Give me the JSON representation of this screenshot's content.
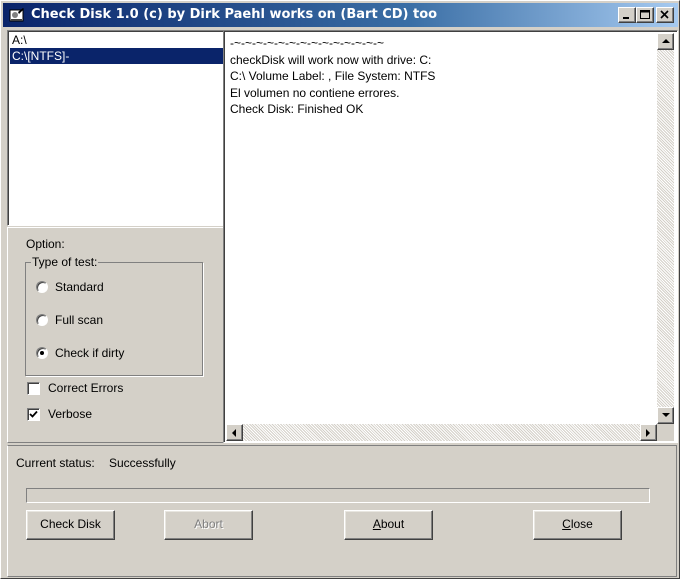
{
  "window": {
    "title": "Check Disk 1.0  (c) by Dirk Paehl works on (Bart CD) too",
    "app_icon": "checkdisk-app-icon",
    "controls": [
      "minimize-icon",
      "maximize-icon",
      "close-icon"
    ]
  },
  "drives": {
    "items": [
      {
        "label": "A:\\",
        "selected": false
      },
      {
        "label": "C:\\[NTFS]-",
        "selected": true
      }
    ]
  },
  "options": {
    "title": "Option:",
    "type_of_test": {
      "title": "Type of test:",
      "choices": [
        {
          "label": "Standard",
          "checked": false
        },
        {
          "label": "Full scan",
          "checked": false
        },
        {
          "label": "Check if dirty",
          "checked": true
        }
      ]
    },
    "correct_errors": {
      "label": "Correct Errors",
      "checked": false
    },
    "verbose": {
      "label": "Verbose",
      "checked": true
    }
  },
  "output": {
    "lines": [
      "-~-~-~-~-~-~-~-~-~-~-~-~-~-~",
      "checkDisk will work now with drive: C:",
      "C:\\ Volume Label: , File System: NTFS",
      "El volumen no contiene errores.",
      "Check Disk: Finished OK"
    ]
  },
  "status": {
    "label": "Current status:",
    "value": "Successfully",
    "progress": 0
  },
  "buttons": {
    "check_disk": "Check Disk",
    "abort": "Abort",
    "about_prefix": "",
    "about_hotkey": "A",
    "about_rest": "bout",
    "close_hotkey": "C",
    "close_rest": "lose"
  },
  "colors": {
    "face": "#d4d0c8",
    "title_start": "#0a246a",
    "title_end": "#a6caf0",
    "selection": "#0a246a"
  }
}
